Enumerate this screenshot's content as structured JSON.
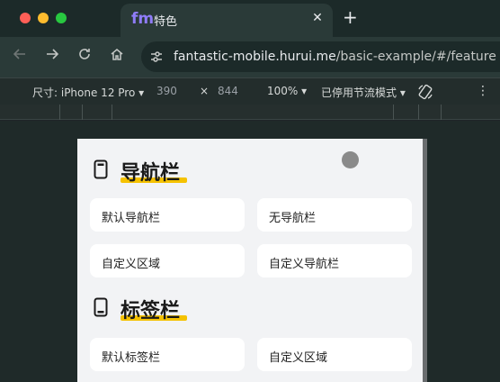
{
  "browser": {
    "tab": {
      "favicon_text": "fm",
      "title": "特色",
      "close_glyph": "✕"
    },
    "new_tab_glyph": "+",
    "url": {
      "host": "fantastic-mobile.hurui.me",
      "path": "/basic-example/#/feature"
    }
  },
  "device_toolbar": {
    "dimensions_label": "尺寸: iPhone 12 Pro",
    "width": "390",
    "times": "×",
    "height": "844",
    "zoom": "100%",
    "throttle": "已停用节流模式"
  },
  "page": {
    "sections": [
      {
        "title": "导航栏",
        "icon": "phone-navbar-icon",
        "items": [
          "默认导航栏",
          "无导航栏",
          "自定义区域",
          "自定义导航栏"
        ]
      },
      {
        "title": "标签栏",
        "icon": "phone-tabbar-icon",
        "items": [
          "默认标签栏",
          "自定义区域"
        ]
      }
    ]
  },
  "colors": {
    "accent_underline": "#f5c200",
    "favicon": "#8f7cf8"
  }
}
